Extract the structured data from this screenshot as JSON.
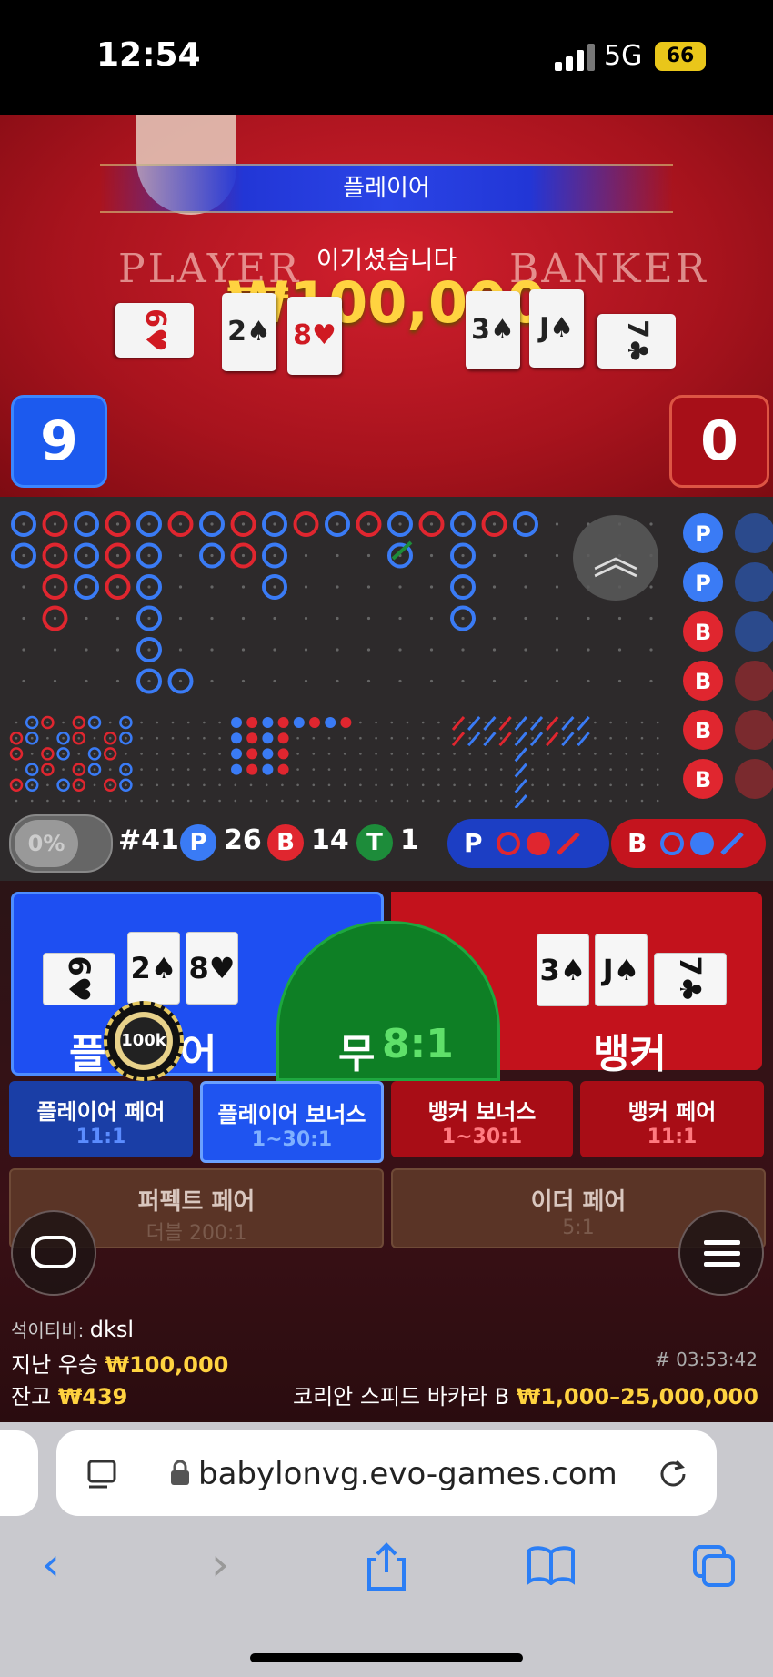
{
  "status_bar": {
    "time": "12:54",
    "network": "5G",
    "battery": "66"
  },
  "video": {
    "result_banner": "플레이어",
    "win_message": "이기셨습니다",
    "win_amount": "₩100,000",
    "table_player": "PLAYER",
    "table_banker": "BANKER",
    "player_score": "9",
    "banker_score": "0"
  },
  "roadmap": {
    "bead_road_right": [
      "P",
      "P",
      "B",
      "B",
      "B",
      "B"
    ],
    "stats": {
      "toggle": "0%",
      "round": "#41",
      "player_label": "P",
      "player_count": "26",
      "banker_label": "B",
      "banker_count": "14",
      "tie_label": "T",
      "tie_count": "1"
    },
    "predict_player": "P",
    "predict_banker": "B",
    "colors": {
      "player": "#3a7bf5",
      "banker": "#e0262f",
      "tie": "#1d8c3a"
    }
  },
  "betting": {
    "player_label": "플레이어",
    "player_label_prefix": "플",
    "player_label_suffix": "어",
    "tie_label": "무",
    "tie_odds": "8:1",
    "banker_label": "뱅커",
    "chip": "100k",
    "player_cards": [
      "6♥",
      "2♠",
      "8♥"
    ],
    "banker_cards": [
      "3♠",
      "J♠",
      "7♣"
    ],
    "side_bets": [
      {
        "name": "플레이어 페어",
        "odds": "11:1"
      },
      {
        "name": "플레이어 보너스",
        "odds": "1~30:1"
      },
      {
        "name": "뱅커 보너스",
        "odds": "1~30:1"
      },
      {
        "name": "뱅커 페어",
        "odds": "11:1"
      }
    ],
    "extra_bets": [
      {
        "name": "퍼펙트 페어",
        "odds": "더블 200:1"
      },
      {
        "name": "이더 페어",
        "odds": "5:1"
      }
    ]
  },
  "footer": {
    "dealer_label": "석이티비:",
    "dealer_name": "dksl",
    "last_win_label": "지난 우승",
    "last_win_amount": "₩100,000",
    "balance_label": "잔고",
    "balance_amount": "₩439",
    "game_id": "# 03:53:42",
    "table_name": "코리안 스피드 바카라 B",
    "limits": "₩1,000–25,000,000"
  },
  "browser": {
    "url": "babylonvg.evo-games.com"
  }
}
